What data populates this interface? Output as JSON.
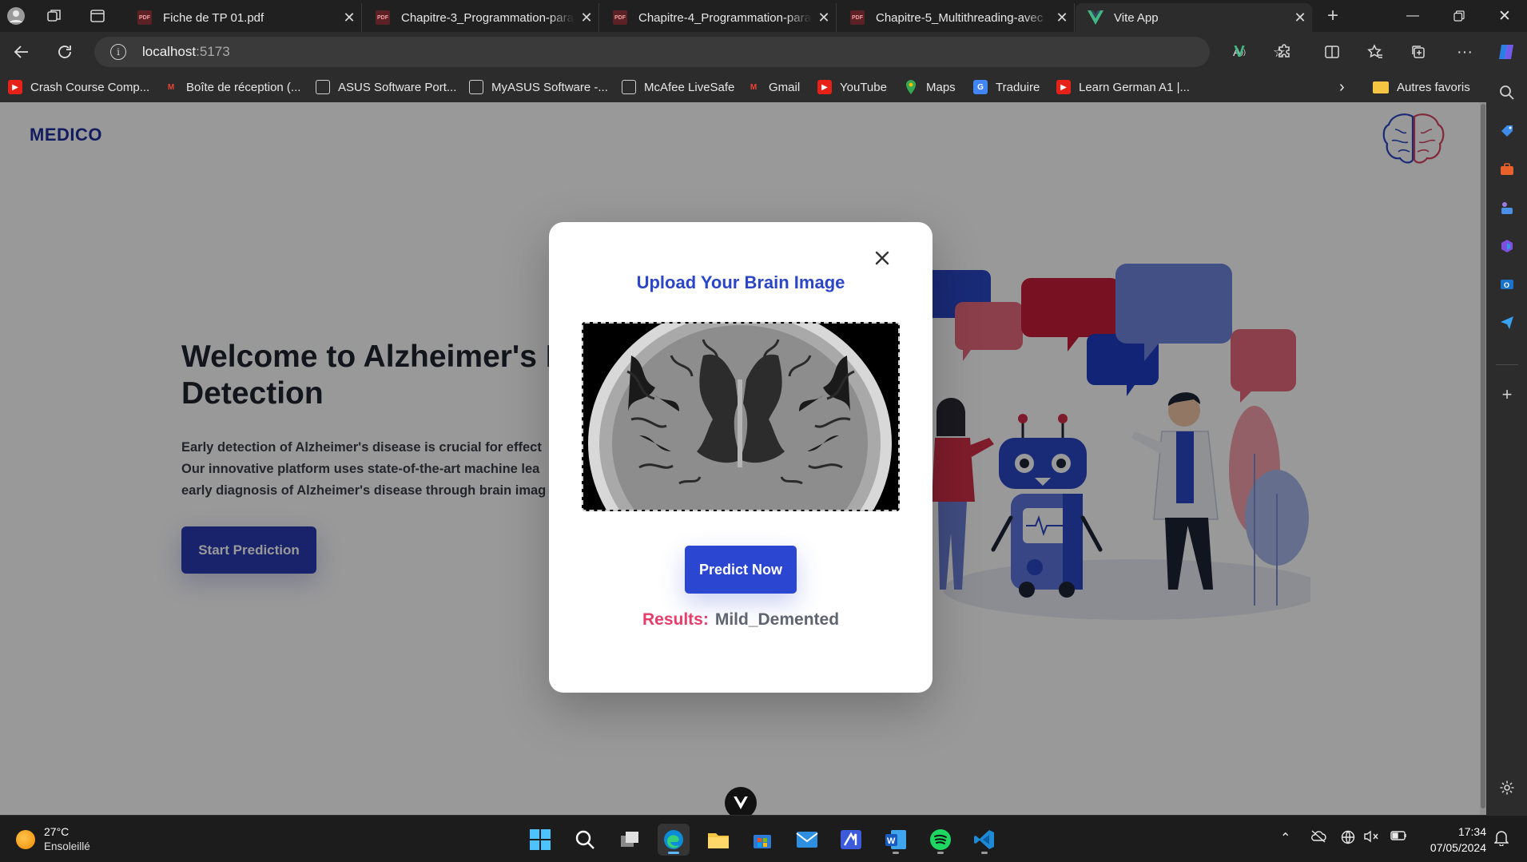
{
  "browser": {
    "tabs": [
      {
        "title": "Fiche de TP 01.pdf",
        "icon": "pdf-icon"
      },
      {
        "title": "Chapitre-3_Programmation-para",
        "icon": "pdf-icon"
      },
      {
        "title": "Chapitre-4_Programmation-para",
        "icon": "pdf-icon"
      },
      {
        "title": "Chapitre-5_Multithreading-avec",
        "icon": "pdf-icon"
      },
      {
        "title": "Vite App",
        "icon": "vue-icon",
        "active": true
      }
    ],
    "address": {
      "host": "localhost",
      "port": ":5173"
    },
    "favorites": [
      {
        "label": "Crash Course Comp...",
        "icon": "youtube-icon"
      },
      {
        "label": "Boîte de réception (...",
        "icon": "gmail-icon"
      },
      {
        "label": "ASUS Software Port...",
        "icon": "page-icon"
      },
      {
        "label": "MyASUS Software -...",
        "icon": "page-icon"
      },
      {
        "label": "McAfee LiveSafe",
        "icon": "page-icon"
      },
      {
        "label": "Gmail",
        "icon": "gmail-icon"
      },
      {
        "label": "YouTube",
        "icon": "youtube-icon"
      },
      {
        "label": "Maps",
        "icon": "maps-icon"
      },
      {
        "label": "Traduire",
        "icon": "translate-icon"
      },
      {
        "label": "Learn German A1 |...",
        "icon": "youtube-icon"
      }
    ],
    "other_favorites": "Autres favoris"
  },
  "page": {
    "brand": "MEDICO",
    "hero": {
      "title_line1": "Welcome to Alzheimer's D",
      "title_line2": "Detection",
      "text_line1": "Early detection of Alzheimer's disease is crucial for effect",
      "text_line2": "Our innovative platform uses state-of-the-art machine lea",
      "text_line3": "early diagnosis of Alzheimer's disease through brain imag",
      "cta": "Start Prediction"
    },
    "colors": {
      "primary": "#2b46d0",
      "brand": "#1e2f9e",
      "result_label": "#e63d6b"
    }
  },
  "modal": {
    "title": "Upload Your Brain Image",
    "predict_button": "Predict Now",
    "result_label": "Results:",
    "result_value": "Mild_Demented"
  },
  "taskbar": {
    "weather": {
      "temp": "27°C",
      "desc": "Ensoleillé"
    },
    "time": "17:34",
    "date": "07/05/2024"
  }
}
